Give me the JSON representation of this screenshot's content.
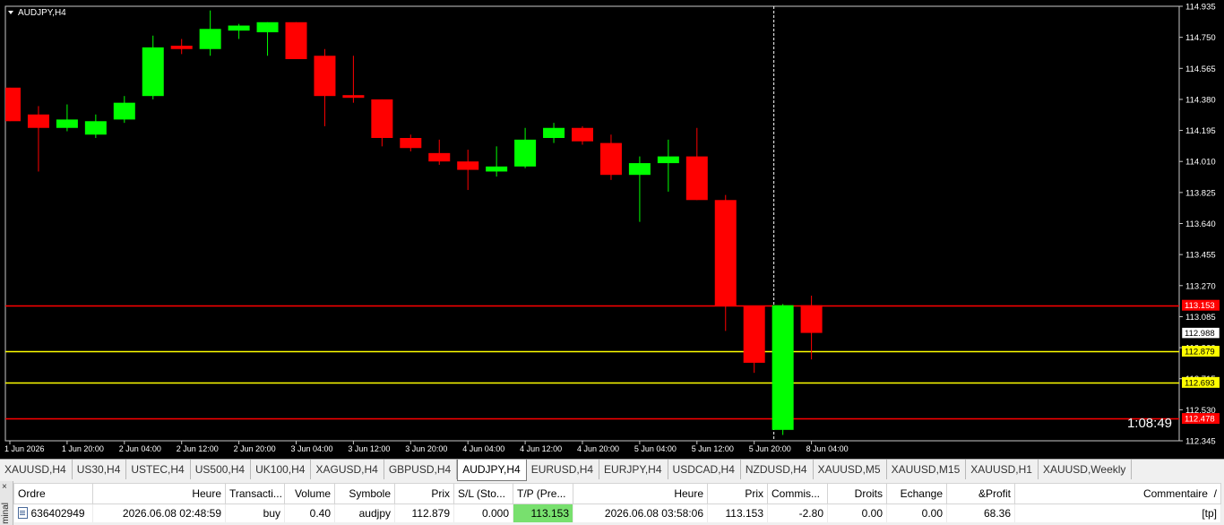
{
  "chart_title": "AUDJPY,H4",
  "chart_data": {
    "type": "candlestick",
    "symbol": "AUDJPY",
    "timeframe": "H4",
    "ylim": [
      112.345,
      114.935
    ],
    "price_ticks": [
      "114.935",
      "114.750",
      "114.565",
      "114.380",
      "114.195",
      "114.010",
      "113.825",
      "113.640",
      "113.455",
      "113.270",
      "113.085",
      "112.900",
      "112.715",
      "112.530",
      "112.345"
    ],
    "time_labels": [
      "1 Jun 2026",
      "1 Jun 20:00",
      "2 Jun 04:00",
      "2 Jun 12:00",
      "2 Jun 20:00",
      "3 Jun 04:00",
      "3 Jun 12:00",
      "3 Jun 20:00",
      "4 Jun 04:00",
      "4 Jun 12:00",
      "4 Jun 20:00",
      "5 Jun 04:00",
      "5 Jun 12:00",
      "5 Jun 20:00",
      "8 Jun 04:00"
    ],
    "time_label_every": 2,
    "candles": [
      {
        "o": 114.45,
        "h": 114.45,
        "l": 114.25,
        "c": 114.25
      },
      {
        "o": 114.29,
        "h": 114.34,
        "l": 113.95,
        "c": 114.21
      },
      {
        "o": 114.21,
        "h": 114.35,
        "l": 114.19,
        "c": 114.26
      },
      {
        "o": 114.17,
        "h": 114.29,
        "l": 114.15,
        "c": 114.25
      },
      {
        "o": 114.26,
        "h": 114.4,
        "l": 114.24,
        "c": 114.36
      },
      {
        "o": 114.4,
        "h": 114.76,
        "l": 114.38,
        "c": 114.69
      },
      {
        "o": 114.7,
        "h": 114.74,
        "l": 114.65,
        "c": 114.68
      },
      {
        "o": 114.68,
        "h": 114.91,
        "l": 114.64,
        "c": 114.8
      },
      {
        "o": 114.79,
        "h": 114.83,
        "l": 114.74,
        "c": 114.82
      },
      {
        "o": 114.78,
        "h": 114.84,
        "l": 114.64,
        "c": 114.84
      },
      {
        "o": 114.84,
        "h": 114.84,
        "l": 114.62,
        "c": 114.62
      },
      {
        "o": 114.64,
        "h": 114.68,
        "l": 114.22,
        "c": 114.4
      },
      {
        "o": 114.4,
        "h": 114.64,
        "l": 114.36,
        "c": 114.39
      },
      {
        "o": 114.38,
        "h": 114.38,
        "l": 114.1,
        "c": 114.15
      },
      {
        "o": 114.15,
        "h": 114.17,
        "l": 114.07,
        "c": 114.09
      },
      {
        "o": 114.06,
        "h": 114.14,
        "l": 113.99,
        "c": 114.01
      },
      {
        "o": 114.01,
        "h": 114.08,
        "l": 113.84,
        "c": 113.96
      },
      {
        "o": 113.95,
        "h": 114.1,
        "l": 113.92,
        "c": 113.98
      },
      {
        "o": 113.98,
        "h": 114.21,
        "l": 113.97,
        "c": 114.14
      },
      {
        "o": 114.15,
        "h": 114.24,
        "l": 114.12,
        "c": 114.21
      },
      {
        "o": 114.21,
        "h": 114.22,
        "l": 114.11,
        "c": 114.13
      },
      {
        "o": 114.12,
        "h": 114.17,
        "l": 113.9,
        "c": 113.93
      },
      {
        "o": 113.93,
        "h": 114.04,
        "l": 113.65,
        "c": 114.0
      },
      {
        "o": 114.0,
        "h": 114.14,
        "l": 113.83,
        "c": 114.04
      },
      {
        "o": 114.04,
        "h": 114.21,
        "l": 113.78,
        "c": 113.78
      },
      {
        "o": 113.78,
        "h": 113.81,
        "l": 113.0,
        "c": 113.15
      },
      {
        "o": 113.15,
        "h": 113.15,
        "l": 112.75,
        "c": 112.81
      },
      {
        "o": 112.41,
        "h": 113.16,
        "l": 112.38,
        "c": 113.153
      },
      {
        "o": 113.153,
        "h": 113.21,
        "l": 112.83,
        "c": 112.988
      }
    ],
    "levels": [
      {
        "price": 113.153,
        "label": "113.153",
        "color": "#ff0000",
        "label_bg": "#ff0000",
        "label_fg": "#ffffff"
      },
      {
        "price": 112.879,
        "label": "112.879",
        "color": "#ffff00",
        "label_bg": "#ffff00",
        "label_fg": "#000000"
      },
      {
        "price": 112.693,
        "label": "112.693",
        "color": "#ffff00",
        "label_bg": "#ffff00",
        "label_fg": "#000000"
      },
      {
        "price": 112.478,
        "label": "112.478",
        "color": "#ff0000",
        "label_bg": "#ff0000",
        "label_fg": "#ffffff"
      }
    ],
    "current_price": {
      "price": 112.988,
      "label": "112.988"
    },
    "crosshair_candle_index": 27,
    "countdown": "1:08:49",
    "colors": {
      "up": "#00ff00",
      "down": "#ff0000",
      "background": "#000000",
      "axis_text": "#ffffff"
    }
  },
  "tabs": [
    {
      "label": "XAUUSD,H4",
      "active": false
    },
    {
      "label": "US30,H4",
      "active": false
    },
    {
      "label": "USTEC,H4",
      "active": false
    },
    {
      "label": "US500,H4",
      "active": false
    },
    {
      "label": "UK100,H4",
      "active": false
    },
    {
      "label": "XAGUSD,H4",
      "active": false
    },
    {
      "label": "GBPUSD,H4",
      "active": false
    },
    {
      "label": "AUDJPY,H4",
      "active": true
    },
    {
      "label": "EURUSD,H4",
      "active": false
    },
    {
      "label": "EURJPY,H4",
      "active": false
    },
    {
      "label": "USDCAD,H4",
      "active": false
    },
    {
      "label": "NZDUSD,H4",
      "active": false
    },
    {
      "label": "XAUUSD,M5",
      "active": false
    },
    {
      "label": "XAUUSD,M15",
      "active": false
    },
    {
      "label": "XAUUSD,H1",
      "active": false
    },
    {
      "label": "XAUUSD,Weekly",
      "active": false
    }
  ],
  "terminal": {
    "side_close": "×",
    "side_label": "minal",
    "columns": [
      "Ordre",
      "Heure",
      "Transacti...",
      "Volume",
      "Symbole",
      "Prix",
      "S/L (Sto...",
      "T/P (Pre...",
      "Heure",
      "Prix",
      "Commis...",
      "Droits",
      "Echange",
      "&Profit",
      "Commentaire"
    ],
    "sort_indicator": "/",
    "row": {
      "ordre": "636402949",
      "heure_open": "2026.06.08 02:48:59",
      "type": "buy",
      "volume": "0.40",
      "symbole": "audjpy",
      "prix_open": "112.879",
      "sl": "0.000",
      "tp": "113.153",
      "heure_now": "2026.06.08 03:58:06",
      "prix_now": "113.153",
      "commission": "-2.80",
      "droits": "0.00",
      "echange": "0.00",
      "profit": "68.36",
      "commentaire": "[tp]"
    }
  }
}
